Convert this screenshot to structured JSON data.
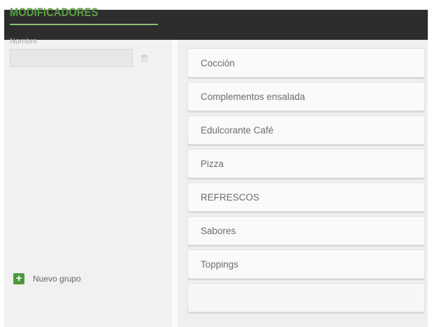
{
  "header": {},
  "sidebar": {
    "title": "MODIFICADORES",
    "name_label": "Nombre",
    "name_value": "",
    "new_group_label": "Nuevo grupo",
    "accent_color": "#5da046"
  },
  "groups": [
    {
      "label": "Cocción"
    },
    {
      "label": "Complementos ensalada"
    },
    {
      "label": "Edulcorante Café"
    },
    {
      "label": "Pizza"
    },
    {
      "label": "REFRESCOS"
    },
    {
      "label": "Sabores"
    },
    {
      "label": "Toppings"
    },
    {
      "label": ""
    }
  ],
  "icons": {
    "delete": "trash-icon",
    "add": "plus-icon"
  }
}
